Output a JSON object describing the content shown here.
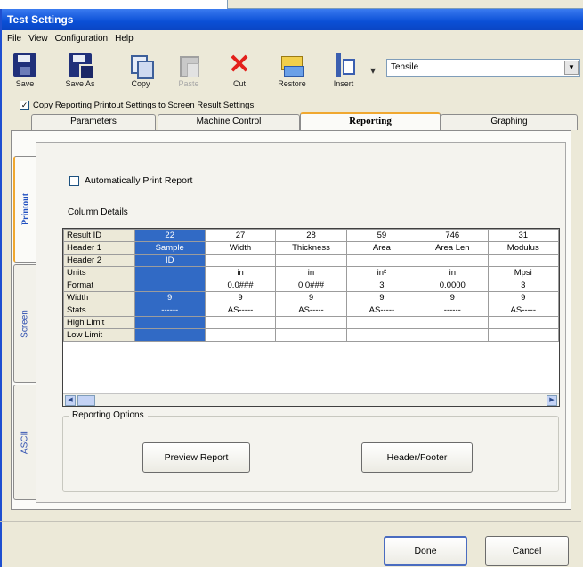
{
  "window": {
    "title": "Test Settings"
  },
  "menu": [
    "File",
    "View",
    "Configuration",
    "Help"
  ],
  "toolbar": {
    "buttons": [
      {
        "label": "Save",
        "icon": "save-icon",
        "enabled": true
      },
      {
        "label": "Save As",
        "icon": "save-as-icon",
        "enabled": true
      },
      {
        "label": "Copy",
        "icon": "copy-icon",
        "enabled": true
      },
      {
        "label": "Paste",
        "icon": "paste-icon",
        "enabled": false
      },
      {
        "label": "Cut",
        "icon": "cut-icon",
        "enabled": true
      },
      {
        "label": "Restore",
        "icon": "restore-icon",
        "enabled": true
      },
      {
        "label": "Insert",
        "icon": "insert-icon",
        "enabled": true
      }
    ],
    "combo_value": "Tensile"
  },
  "copy_settings": {
    "checked": true,
    "label": "Copy Reporting Printout Settings to Screen Result Settings"
  },
  "tabs": [
    {
      "label": "Parameters",
      "active": false
    },
    {
      "label": "Machine Control",
      "active": false
    },
    {
      "label": "Reporting",
      "active": true
    },
    {
      "label": "Graphing",
      "active": false
    }
  ],
  "side_tabs": [
    {
      "label": "Printout",
      "active": true
    },
    {
      "label": "Screen",
      "active": false
    },
    {
      "label": "ASCII",
      "active": false
    }
  ],
  "printout": {
    "auto_print": {
      "checked": false,
      "label": "Automatically Print Report"
    },
    "column_details_label": "Column Details",
    "grid": {
      "row_headers": [
        "Result ID",
        "Header 1",
        "Header 2",
        "Units",
        "Format",
        "Width",
        "Stats",
        "High Limit",
        "Low Limit"
      ],
      "columns": [
        {
          "values": [
            "22",
            "Sample",
            "ID",
            "",
            "",
            "9",
            "------",
            "",
            ""
          ]
        },
        {
          "values": [
            "27",
            "Width",
            "",
            "in",
            "0.0###",
            "9",
            "AS-----",
            "",
            ""
          ]
        },
        {
          "values": [
            "28",
            "Thickness",
            "",
            "in",
            "0.0###",
            "9",
            "AS-----",
            "",
            ""
          ]
        },
        {
          "values": [
            "59",
            "Area",
            "",
            "in²",
            "3",
            "9",
            "AS-----",
            "",
            ""
          ]
        },
        {
          "values": [
            "746",
            "Area Len",
            "",
            "in",
            "0.0000",
            "9",
            "------",
            "",
            ""
          ]
        },
        {
          "values": [
            "31",
            "Modulus",
            "",
            "Mpsi",
            "3",
            "9",
            "AS-----",
            "",
            ""
          ]
        }
      ],
      "selected_column_index": 0
    },
    "reporting_options": {
      "label": "Reporting Options",
      "preview_button": "Preview Report",
      "header_footer_button": "Header/Footer"
    }
  },
  "footer": {
    "done": "Done",
    "cancel": "Cancel"
  }
}
